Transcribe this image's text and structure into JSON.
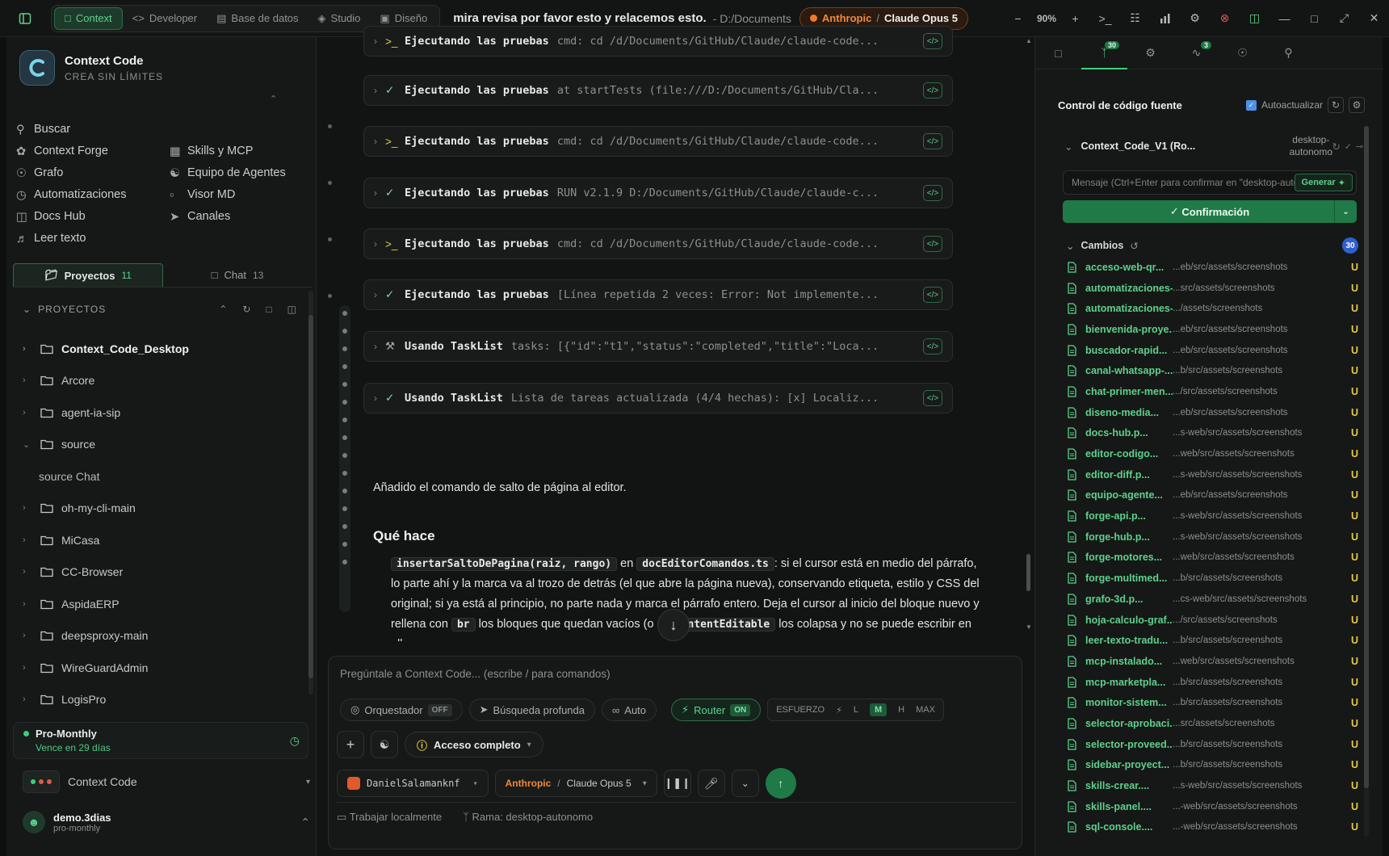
{
  "topbar": {
    "tabs": [
      {
        "label": "Context",
        "icon": "chat-icon"
      },
      {
        "label": "Developer",
        "icon": "code-icon"
      },
      {
        "label": "Base de datos",
        "icon": "database-icon"
      },
      {
        "label": "Studio",
        "icon": "layers-icon"
      },
      {
        "label": "Diseño",
        "icon": "image-icon"
      }
    ],
    "title": "mira revisa por favor esto y relacemos esto.",
    "path": "- D:/Documents",
    "provider": "Anthropic",
    "separator": "/",
    "model": "Claude Opus 5",
    "zoom": "90%"
  },
  "sidebar": {
    "brand": {
      "name": "Context Code",
      "tagline": "CREA SIN LÍMITES"
    },
    "menu": [
      {
        "label": "Buscar",
        "icon": "search-icon"
      },
      {
        "label": "",
        "icon": ""
      },
      {
        "label": "Context Forge",
        "icon": "forge-icon"
      },
      {
        "label": "Skills y MCP",
        "icon": "grid-icon"
      },
      {
        "label": "Grafo",
        "icon": "graph-icon"
      },
      {
        "label": "Equipo de Agentes",
        "icon": "team-icon"
      },
      {
        "label": "Automatizaciones",
        "icon": "clock-icon"
      },
      {
        "label": "Visor MD",
        "icon": "doc-icon"
      },
      {
        "label": "Docs Hub",
        "icon": "book-icon"
      },
      {
        "label": "Canales",
        "icon": "send-icon"
      },
      {
        "label": "Leer texto",
        "icon": "speaker-icon"
      }
    ],
    "tabs": [
      {
        "label": "Proyectos",
        "count": "11"
      },
      {
        "label": "Chat",
        "count": "13"
      }
    ],
    "projects_header": "PROYECTOS",
    "projects": [
      {
        "name": "Context_Code_Desktop",
        "expanded": false,
        "bold": true
      },
      {
        "name": "Arcore"
      },
      {
        "name": "agent-ia-sip"
      },
      {
        "name": "source",
        "expanded": true
      },
      {
        "name": "source Chat",
        "child": true
      },
      {
        "name": "oh-my-cli-main"
      },
      {
        "name": "MiCasa"
      },
      {
        "name": "CC-Browser"
      },
      {
        "name": "AspidaERP"
      },
      {
        "name": "deepsproxy-main"
      },
      {
        "name": "WireGuardAdmin"
      },
      {
        "name": "LogisPro"
      }
    ],
    "plan": {
      "name": "Pro-Monthly",
      "expires": "Vence en 29 días"
    },
    "workspace": "Context Code",
    "user": {
      "name": "demo.3dias",
      "role": "pro-monthly"
    }
  },
  "chat": {
    "tools": [
      {
        "name": "Ejecutando las pruebas",
        "desc": "cmd: cd /d/Documents/GitHub/Claude/claude-code...",
        "status": "terminal"
      },
      {
        "name": "Ejecutando las pruebas",
        "desc": "at startTests (file:///D:/Documents/GitHub/Cla...",
        "status": "done"
      },
      {
        "name": "Ejecutando las pruebas",
        "desc": "cmd: cd /d/Documents/GitHub/Claude/claude-code...",
        "status": "terminal"
      },
      {
        "name": "Ejecutando las pruebas",
        "desc": "RUN v2.1.9 D:/Documents/GitHub/Claude/claude-c...",
        "status": "done"
      },
      {
        "name": "Ejecutando las pruebas",
        "desc": "cmd: cd /d/Documents/GitHub/Claude/claude-code...",
        "status": "terminal"
      },
      {
        "name": "Ejecutando las pruebas",
        "desc": "[Línea repetida 2 veces: Error: Not implemente...",
        "status": "done"
      },
      {
        "name": "Usando TaskList",
        "desc": "tasks: [{\"id\":\"t1\",\"status\":\"completed\",\"title\":\"Loca...",
        "status": "tool"
      },
      {
        "name": "Usando TaskList",
        "desc": "Lista de tareas actualizada (4/4 hechas): [x] Localiz...",
        "status": "done"
      }
    ],
    "summary": "Añadido el comando de salto de página al editor.",
    "heading": "Qué hace",
    "bullet": {
      "code1": "insertarSaltoDePagina(raiz, rango)",
      "t1": " en ",
      "code2": "docEditorComandos.ts",
      "t2": ": si el cursor está en medio del párrafo, lo parte ahí y la marca va al trozo de detrás (el que abre la página nueva), conservando etiqueta, estilo y CSS del original; si ya está al principio, no parte nada y marca el párrafo entero. Deja el cursor al inicio del bloque nuevo y rellena con ",
      "code3": "br",
      "t3": " los bloques que quedan vacíos (o el ",
      "code4": "contentEditable",
      "t4": " los colapsa y no se puede escribir en ellos"
    },
    "composer": {
      "placeholder": "Pregúntale a Context Code... (escribe / para comandos)",
      "orchestrator": "Orquestador",
      "orchestrator_state": "OFF",
      "deep_search": "Búsqueda profunda",
      "auto": "Auto",
      "router": "Router",
      "router_state": "ON",
      "effort_label": "ESFUERZO",
      "effort_levels": [
        "L",
        "M",
        "H",
        "MAX"
      ],
      "effort_selected": "M",
      "access": "Acceso completo",
      "account": "DanielSalamanknf",
      "provider": "Anthropic",
      "model": "Claude Opus 5",
      "local": "Trabajar localmente",
      "branch": "Rama: desktop-autonomo"
    }
  },
  "scm": {
    "tab_badges": {
      "git": "30",
      "activity": "3"
    },
    "title": "Control de código fuente",
    "autoupdate": "Autoactualizar",
    "repo": "Context_Code_V1 (Ro...",
    "branch_line1": "desktop-",
    "branch_line2": "autonomo",
    "message_placeholder": "Mensaje (Ctrl+Enter para confirmar en \"desktop-autonomo\")",
    "generate": "Generar",
    "confirm": "Confirmación",
    "changes_label": "Cambios",
    "changes_count": "30",
    "files": [
      {
        "name": "acceso-web-qr...",
        "path": "...eb/src/assets/screenshots"
      },
      {
        "name": "automatizaciones-...",
        "path": "...src/assets/screenshots"
      },
      {
        "name": "automatizaciones-p...",
        "path": ".../assets/screenshots"
      },
      {
        "name": "bienvenida-proye...",
        "path": "...eb/src/assets/screenshots"
      },
      {
        "name": "buscador-rapid...",
        "path": "...eb/src/assets/screenshots"
      },
      {
        "name": "canal-whatsapp-...",
        "path": "...b/src/assets/screenshots"
      },
      {
        "name": "chat-primer-men...",
        "path": ".../src/assets/screenshots"
      },
      {
        "name": "diseno-media...",
        "path": "...eb/src/assets/screenshots"
      },
      {
        "name": "docs-hub.p...",
        "path": "...s-web/src/assets/screenshots"
      },
      {
        "name": "editor-codigo...",
        "path": "...web/src/assets/screenshots"
      },
      {
        "name": "editor-diff.p...",
        "path": "...s-web/src/assets/screenshots"
      },
      {
        "name": "equipo-agente...",
        "path": "...eb/src/assets/screenshots"
      },
      {
        "name": "forge-api.p...",
        "path": "...s-web/src/assets/screenshots"
      },
      {
        "name": "forge-hub.p...",
        "path": "...s-web/src/assets/screenshots"
      },
      {
        "name": "forge-motores...",
        "path": "...web/src/assets/screenshots"
      },
      {
        "name": "forge-multimed...",
        "path": "...b/src/assets/screenshots"
      },
      {
        "name": "grafo-3d.p...",
        "path": "...cs-web/src/assets/screenshots"
      },
      {
        "name": "hoja-calculo-graf...",
        "path": ".../src/assets/screenshots"
      },
      {
        "name": "leer-texto-tradu...",
        "path": "...b/src/assets/screenshots"
      },
      {
        "name": "mcp-instalado...",
        "path": "...web/src/assets/screenshots"
      },
      {
        "name": "mcp-marketpla...",
        "path": "...b/src/assets/screenshots"
      },
      {
        "name": "monitor-sistem...",
        "path": "...b/src/assets/screenshots"
      },
      {
        "name": "selector-aprobaci...",
        "path": "...src/assets/screenshots"
      },
      {
        "name": "selector-proveed...",
        "path": "...b/src/assets/screenshots"
      },
      {
        "name": "sidebar-proyect...",
        "path": "...b/src/assets/screenshots"
      },
      {
        "name": "skills-crear....",
        "path": "...s-web/src/assets/screenshots"
      },
      {
        "name": "skills-panel....",
        "path": "...-web/src/assets/screenshots"
      },
      {
        "name": "sql-console....",
        "path": "...-web/src/assets/screenshots"
      }
    ],
    "status_letter": "U"
  }
}
